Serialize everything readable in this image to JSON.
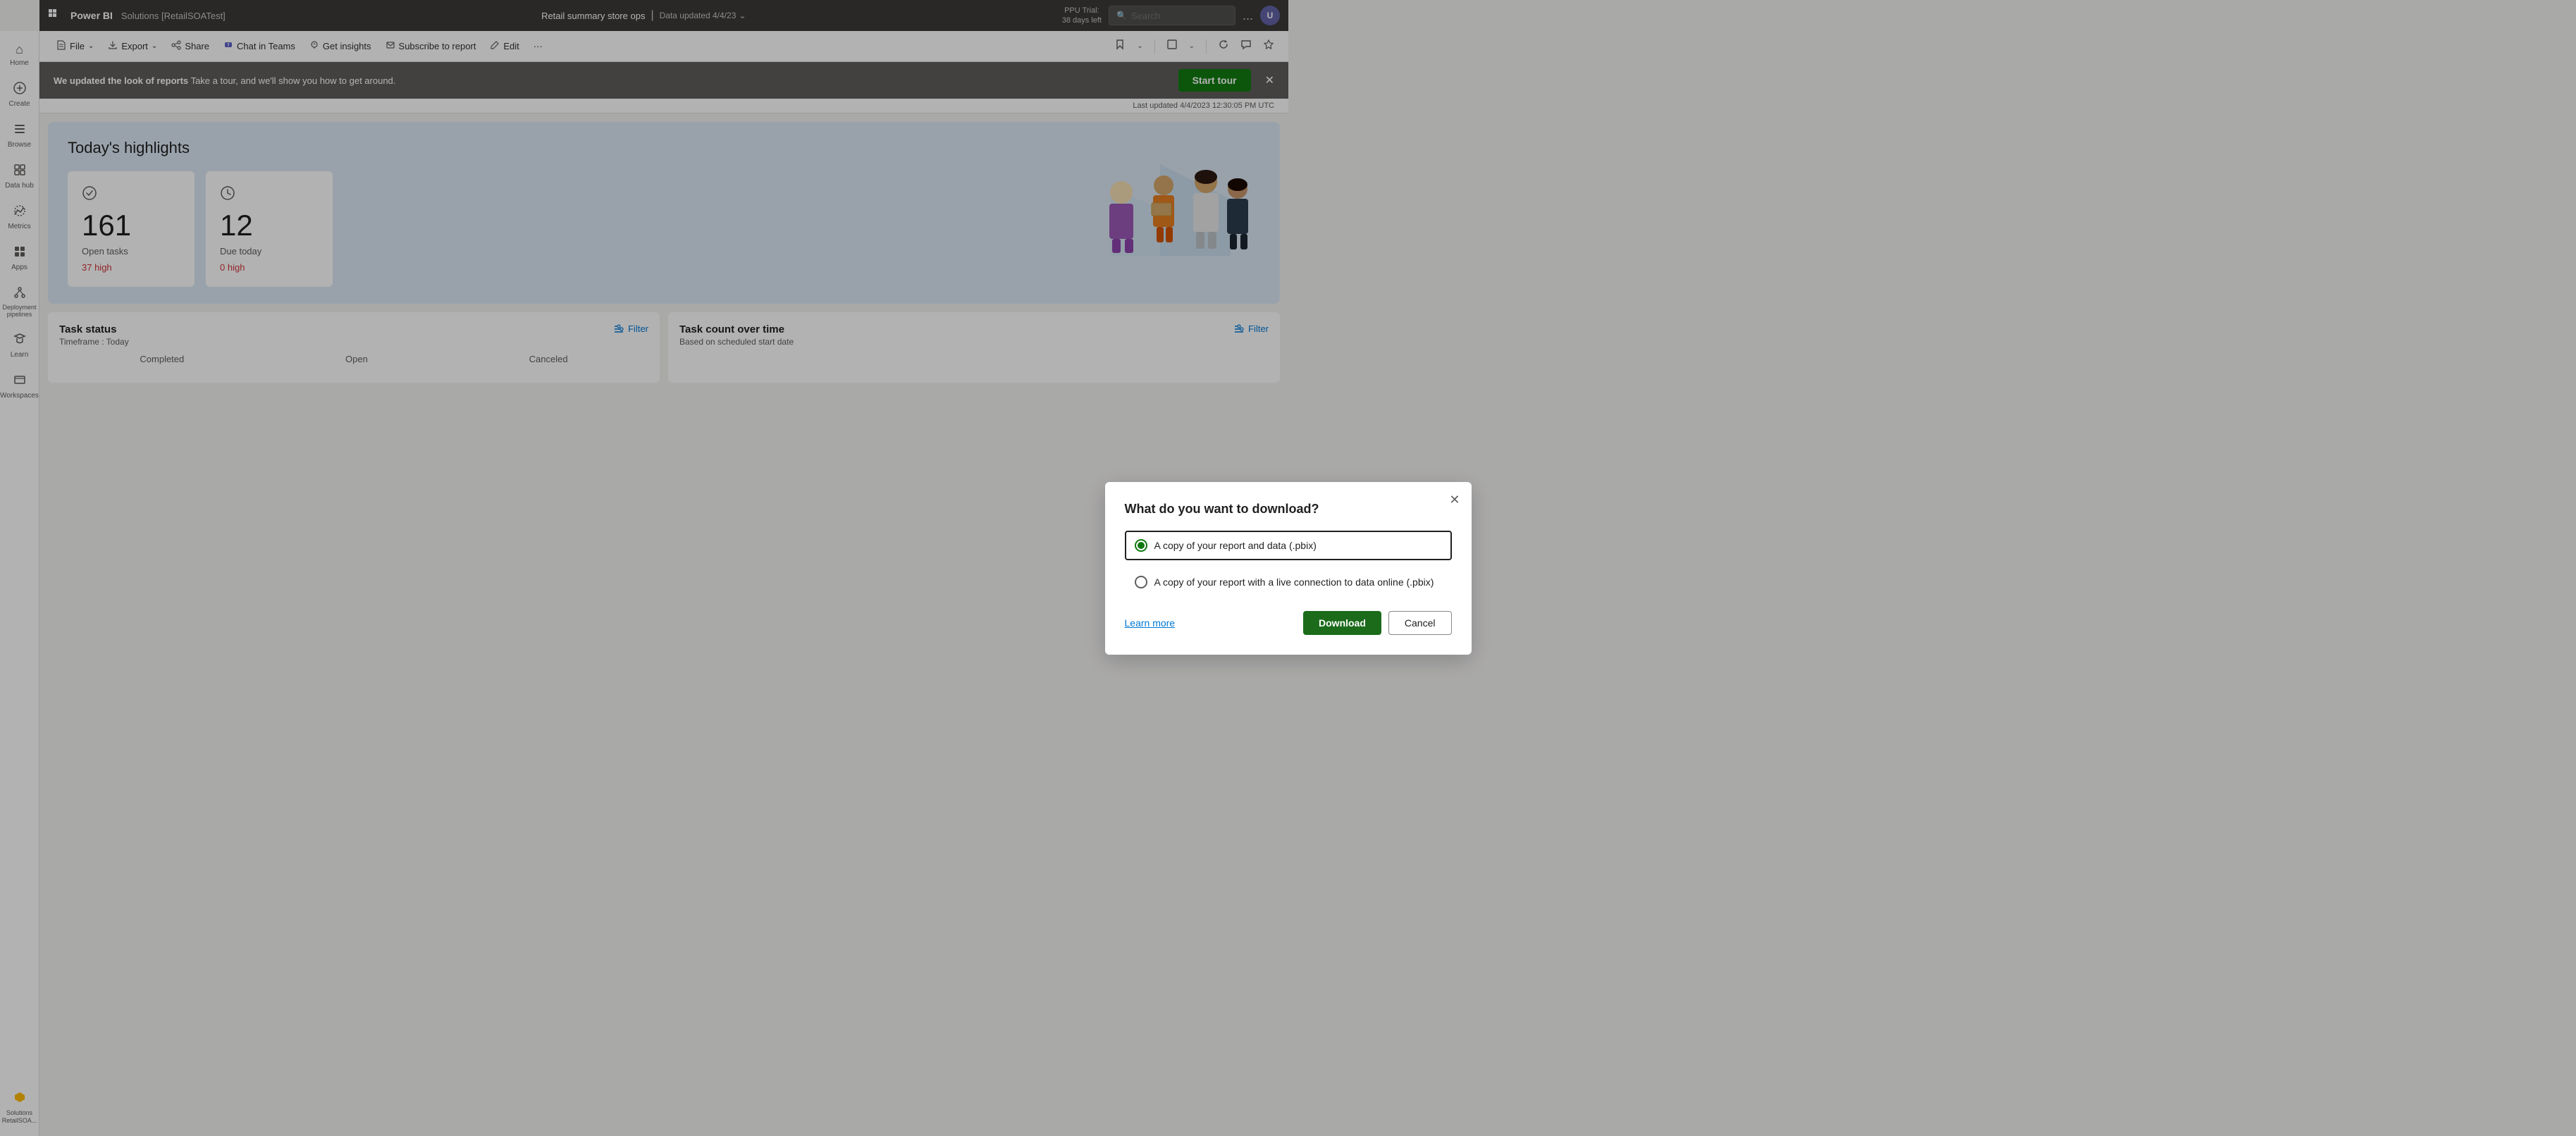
{
  "app": {
    "grid_icon": "⊞",
    "brand": "Power BI",
    "workspace_title": "Solutions [RetailSOATest]",
    "report_name": "Retail summary store ops",
    "separator": "|",
    "data_updated": "Data updated 4/4/23",
    "chevron_down": "⌄",
    "ppu_trial_line1": "PPU Trial:",
    "ppu_trial_line2": "38 days left",
    "search_placeholder": "Search",
    "dots": "...",
    "avatar_initials": "U"
  },
  "toolbar": {
    "file_label": "File",
    "export_label": "Export",
    "share_label": "Share",
    "chat_label": "Chat in Teams",
    "insights_label": "Get insights",
    "subscribe_label": "Subscribe to report",
    "edit_label": "Edit",
    "more_label": "···"
  },
  "banner": {
    "text_bold": "We updated the look of reports",
    "text_normal": " Take a tour, and we'll show you how to get around.",
    "start_tour": "Start tour",
    "close": "✕"
  },
  "last_updated": {
    "text": "Last updated 4/4/2023 12:30:05 PM UTC"
  },
  "highlights": {
    "title": "Today's highlights",
    "cards": [
      {
        "icon": "◎",
        "number": "161",
        "label": "Open tasks",
        "status": "37 high",
        "status_color": "#d13438"
      },
      {
        "icon": "◷",
        "number": "12",
        "label": "Due today",
        "status": "0 high",
        "status_color": "#d13438"
      }
    ]
  },
  "sections": [
    {
      "title": "Task status",
      "subtitle": "Timeframe : Today",
      "filter_label": "Filter",
      "cols": [
        "Completed",
        "Open",
        "Canceled"
      ]
    },
    {
      "title": "Task count over time",
      "subtitle": "Based on scheduled start date",
      "filter_label": "Filter"
    }
  ],
  "sidebar": {
    "items": [
      {
        "icon": "⌂",
        "label": "Home",
        "active": false
      },
      {
        "icon": "+",
        "label": "Create",
        "active": false
      },
      {
        "icon": "⊟",
        "label": "Browse",
        "active": false
      },
      {
        "icon": "⊞",
        "label": "Data hub",
        "active": false
      },
      {
        "icon": "🏆",
        "label": "Metrics",
        "active": false
      },
      {
        "icon": "⊞",
        "label": "Apps",
        "active": false
      },
      {
        "icon": "⬡",
        "label": "Deployment pipelines",
        "active": false
      },
      {
        "icon": "📖",
        "label": "Learn",
        "active": false
      },
      {
        "icon": "⊟",
        "label": "Workspaces",
        "active": false
      },
      {
        "icon": "◆",
        "label": "Solutions RetailSOA...",
        "active": true,
        "special": "solutions"
      }
    ]
  },
  "modal": {
    "title": "What do you want to download?",
    "close": "✕",
    "options": [
      {
        "label": "A copy of your report and data (.pbix)",
        "checked": true
      },
      {
        "label": "A copy of your report with a live connection to data online (.pbix)",
        "checked": false
      }
    ],
    "learn_more": "Learn more",
    "download_btn": "Download",
    "cancel_btn": "Cancel"
  }
}
